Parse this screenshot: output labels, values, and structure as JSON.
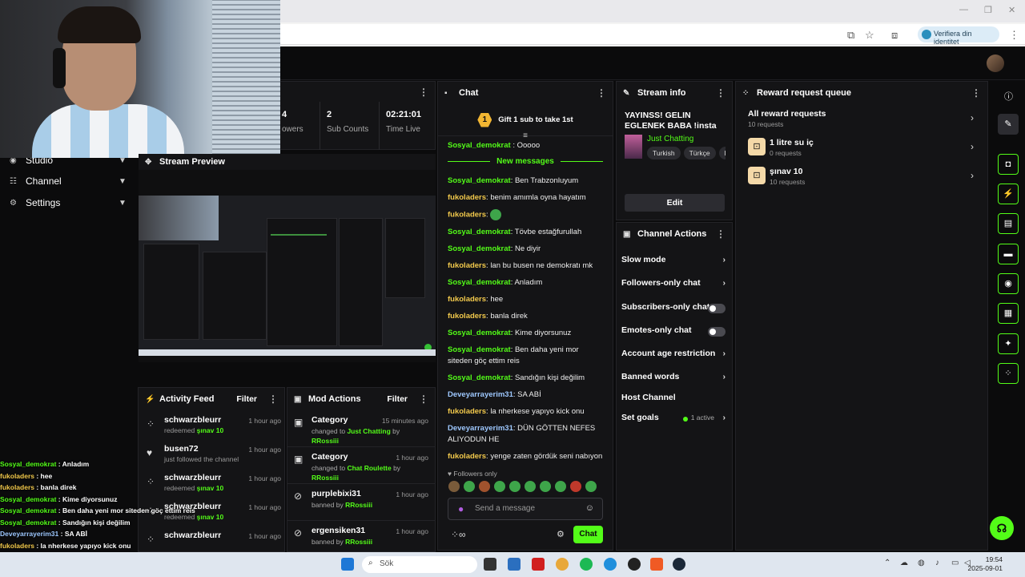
{
  "browser": {
    "verify_label": "Verifiera din identitet",
    "minimize": "—",
    "restore": "❐",
    "close": "✕"
  },
  "stats": [
    {
      "value": "4",
      "label": "owers"
    },
    {
      "value": "2",
      "label": "Sub Counts"
    },
    {
      "value": "02:21:01",
      "label": "Time Live"
    }
  ],
  "nav": [
    {
      "label": "Studio"
    },
    {
      "label": "Channel"
    },
    {
      "label": "Settings"
    }
  ],
  "preview": {
    "title": "Stream Preview"
  },
  "activity": {
    "title": "Activity Feed",
    "filter": "Filter",
    "rows": [
      {
        "name": "schwarzbleurr",
        "sub": "redeemed",
        "reward": "şınav 10",
        "time": "1 hour ago",
        "icon": "reward-icon"
      },
      {
        "name": "busen72",
        "sub": "just followed the channel",
        "reward": "",
        "time": "1 hour ago",
        "icon": "heart-icon"
      },
      {
        "name": "schwarzbleurr",
        "sub": "redeemed",
        "reward": "şınav 10",
        "time": "1 hour ago",
        "icon": "reward-icon"
      },
      {
        "name": "schwarzbleurr",
        "sub": "redeemed",
        "reward": "şınav 10",
        "time": "1 hour ago",
        "icon": "reward-icon"
      },
      {
        "name": "schwarzbleurr",
        "sub": "",
        "reward": "",
        "time": "1 hour ago",
        "icon": "reward-icon"
      }
    ]
  },
  "mod": {
    "title": "Mod Actions",
    "filter": "Filter",
    "rows": [
      {
        "name": "Category",
        "line1": "changed to",
        "hl": "Just Chatting",
        "line2": "by",
        "by": "RRossiii",
        "time": "15 minutes ago"
      },
      {
        "name": "Category",
        "line1": "changed to",
        "hl": "Chat Roulette",
        "line2": "by",
        "by": "RRossiii",
        "time": "1 hour ago"
      },
      {
        "name": "purplebixi31",
        "line1": "banned by",
        "hl": "RRossiii",
        "line2": "",
        "by": "",
        "time": "1 hour ago"
      },
      {
        "name": "ergensiken31",
        "line1": "banned by",
        "hl": "RRossiii",
        "line2": "",
        "by": "",
        "time": "1 hour ago"
      }
    ]
  },
  "overlay_chat": [
    {
      "user": "Sosyal_demokrat",
      "msg": " : Anladım",
      "color": "#53fc18"
    },
    {
      "user": "fukoladers",
      "msg": " : hee",
      "color": "#f2c94c"
    },
    {
      "user": "fukoladers",
      "msg": " : banla direk",
      "color": "#f2c94c"
    },
    {
      "user": "Sosyal_demokrat",
      "msg": " : Kime diyorsunuz",
      "color": "#53fc18"
    },
    {
      "user": "Sosyal_demokrat",
      "msg": " : Ben daha yeni mor siteden göç ettim reis",
      "color": "#53fc18"
    },
    {
      "user": "Sosyal_demokrat",
      "msg": " : Sandığın kişi değilim",
      "color": "#53fc18"
    },
    {
      "user": "Deveyarrayerim31",
      "msg": " : SA ABİ",
      "color": "#9ec8ff"
    },
    {
      "user": "fukoladers",
      "msg": " : la nherkese yapıyo kick onu",
      "color": "#f2c94c"
    },
    {
      "user": "Deveyarrayerim31",
      "msg": " : DÜN GÖTTEN NEFES ALIYODUN HE",
      "color": "#9ec8ff"
    },
    {
      "user": "fukoladers",
      "msg": " : yenge zaten gördük seni nabıyon",
      "color": "#f2c94c"
    }
  ],
  "chat": {
    "title": "Chat",
    "gift": "Gift 1 sub to take 1st",
    "gift_num": "1",
    "new_messages": "New messages",
    "first": {
      "user": "Sosyal_demokrat",
      "msg": ": Ooooo"
    },
    "messages": [
      {
        "user": "Sosyal_demokrat",
        "msg": ": Ben Trabzonluyum",
        "cls": "u1"
      },
      {
        "user": "fukoladers",
        "msg": ": benim amımla oyna hayatım",
        "cls": "u2"
      },
      {
        "user": "fukoladers",
        "msg": ":",
        "cls": "u2",
        "emoji": true
      },
      {
        "user": "Sosyal_demokrat",
        "msg": ": Tövbe estağfurullah",
        "cls": "u1"
      },
      {
        "user": "Sosyal_demokrat",
        "msg": ": Ne diyir",
        "cls": "u1"
      },
      {
        "user": "fukoladers",
        "msg": ": lan bu busen ne demokratı mk",
        "cls": "u2"
      },
      {
        "user": "Sosyal_demokrat",
        "msg": ": Anladım",
        "cls": "u1"
      },
      {
        "user": "fukoladers",
        "msg": ": hee",
        "cls": "u2"
      },
      {
        "user": "fukoladers",
        "msg": ": banla direk",
        "cls": "u2"
      },
      {
        "user": "Sosyal_demokrat",
        "msg": ": Kime diyorsunuz",
        "cls": "u1"
      },
      {
        "user": "Sosyal_demokrat",
        "msg": ": Ben daha yeni mor siteden göç ettim reis",
        "cls": "u1"
      },
      {
        "user": "Sosyal_demokrat",
        "msg": ": Sandığın kişi değilim",
        "cls": "u1"
      },
      {
        "user": "Deveyarrayerim31",
        "msg": ": SA ABİ",
        "cls": "u3"
      },
      {
        "user": "fukoladers",
        "msg": ": la nherkese yapıyo kick onu",
        "cls": "u2"
      },
      {
        "user": "Deveyarrayerim31",
        "msg": ": DÜN GÖTTEN NEFES ALIYODUN HE",
        "cls": "u3"
      },
      {
        "user": "fukoladers",
        "msg": ": yenge zaten gördük seni nabıyon",
        "cls": "u2"
      }
    ],
    "followers_only": "Followers only",
    "placeholder": "Send a message",
    "send": "Chat"
  },
  "stream_info": {
    "title": "Stream info",
    "stream_title": "YAYINSS! GELIN EGLENEK BABA !insta !watchtime !...",
    "category": "Just Chatting",
    "tags": [
      "Turkish",
      "Türkçe",
      "R"
    ],
    "edit": "Edit"
  },
  "channel_actions": {
    "title": "Channel Actions",
    "items": [
      {
        "label": "Slow mode",
        "kind": "chevron"
      },
      {
        "label": "Followers-only chat",
        "kind": "chevron"
      },
      {
        "label": "Subscribers-only chat",
        "kind": "toggle"
      },
      {
        "label": "Emotes-only chat",
        "kind": "toggle"
      },
      {
        "label": "Account age restriction",
        "kind": "chevron"
      },
      {
        "label": "Banned words",
        "kind": "chevron"
      },
      {
        "label": "Host Channel",
        "kind": "none"
      },
      {
        "label": "Set goals",
        "kind": "chevron",
        "extra": "1 active"
      }
    ]
  },
  "rewards": {
    "title": "Reward request queue",
    "all": {
      "name": "All reward requests",
      "count": "10 requests"
    },
    "items": [
      {
        "name": "1 litre su iç",
        "count": "0 requests"
      },
      {
        "name": "şınav 10",
        "count": "10 requests"
      }
    ]
  },
  "taskbar": {
    "search": "Sök",
    "time": "19:54",
    "date": "2025-09-01"
  },
  "colors": {
    "accent": "#53fc18",
    "panel": "#141416",
    "bg": "#0b0b0c"
  }
}
